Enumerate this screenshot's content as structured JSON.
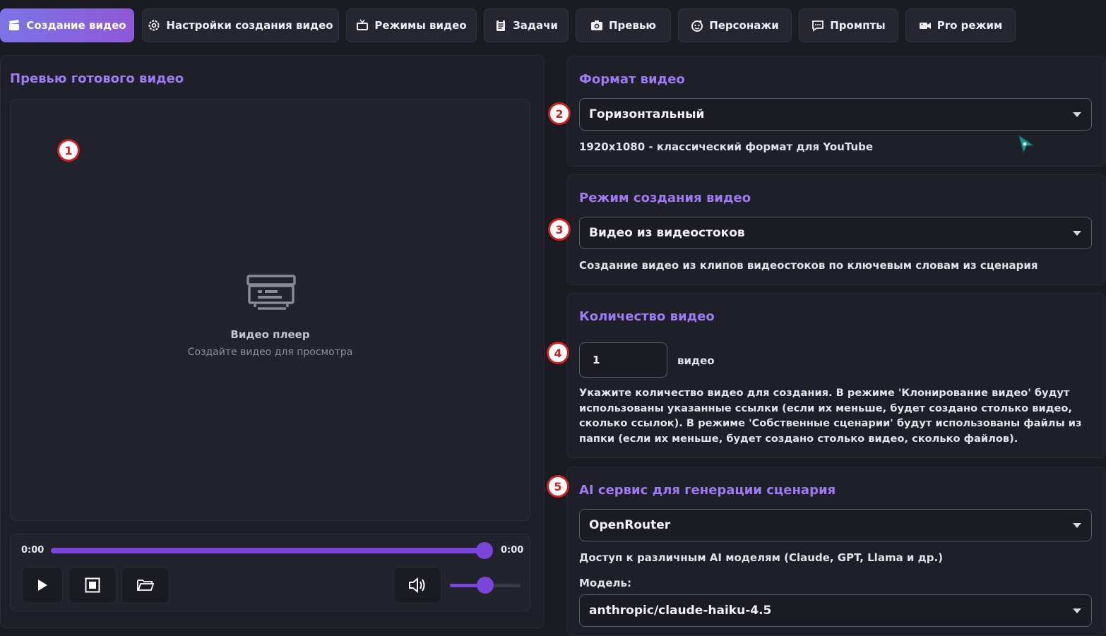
{
  "tabs": [
    {
      "label": "Создание видео",
      "icon": "clapperboard-icon",
      "active": true
    },
    {
      "label": "Настройки создания видео",
      "icon": "gear-icon"
    },
    {
      "label": "Режимы видео",
      "icon": "tv-icon"
    },
    {
      "label": "Задачи",
      "icon": "clipboard-icon"
    },
    {
      "label": "Превью",
      "icon": "camera-icon"
    },
    {
      "label": "Персонажи",
      "icon": "face-icon"
    },
    {
      "label": "Промпты",
      "icon": "chat-icon"
    },
    {
      "label": "Pro режим",
      "icon": "video-camera-icon"
    }
  ],
  "preview": {
    "title": "Превью готового видео",
    "player_title": "Видео плеер",
    "player_subtitle": "Создайте видео для просмотра",
    "time_current": "0:00",
    "time_total": "0:00",
    "seek_progress": 1.0,
    "volume": 0.5
  },
  "format": {
    "title": "Формат видео",
    "selected": "Горизонтальный",
    "description": "1920x1080 - классический формат для YouTube"
  },
  "mode": {
    "title": "Режим создания видео",
    "selected": "Видео из видеостоков",
    "description": "Создание видео из клипов видеостоков по ключевым словам из сценария"
  },
  "count": {
    "title": "Количество видео",
    "value": "1",
    "unit": "видео",
    "description": "Укажите количество видео для создания.  В режиме  'Клонирование видео'  будут использованы указанные ссылки (если их меньше, будет создано столько видео, сколько ссылок).  В режиме  'Собственные сценарии'  будут использованы файлы из папки (если их меньше, будет создано столько видео, сколько файлов)."
  },
  "ai": {
    "title": "AI сервис для генерации сценария",
    "selected": "OpenRouter",
    "description": "Доступ к различным AI моделям (Claude, GPT, Llama и др.)",
    "model_label": "Модель:",
    "model_selected": "anthropic/claude-haiku-4.5"
  },
  "badges": [
    "1",
    "2",
    "3",
    "4",
    "5"
  ],
  "colors": {
    "accent": "#9d7bf0",
    "progress": "#7a45d8",
    "badge_border": "#d32020"
  }
}
